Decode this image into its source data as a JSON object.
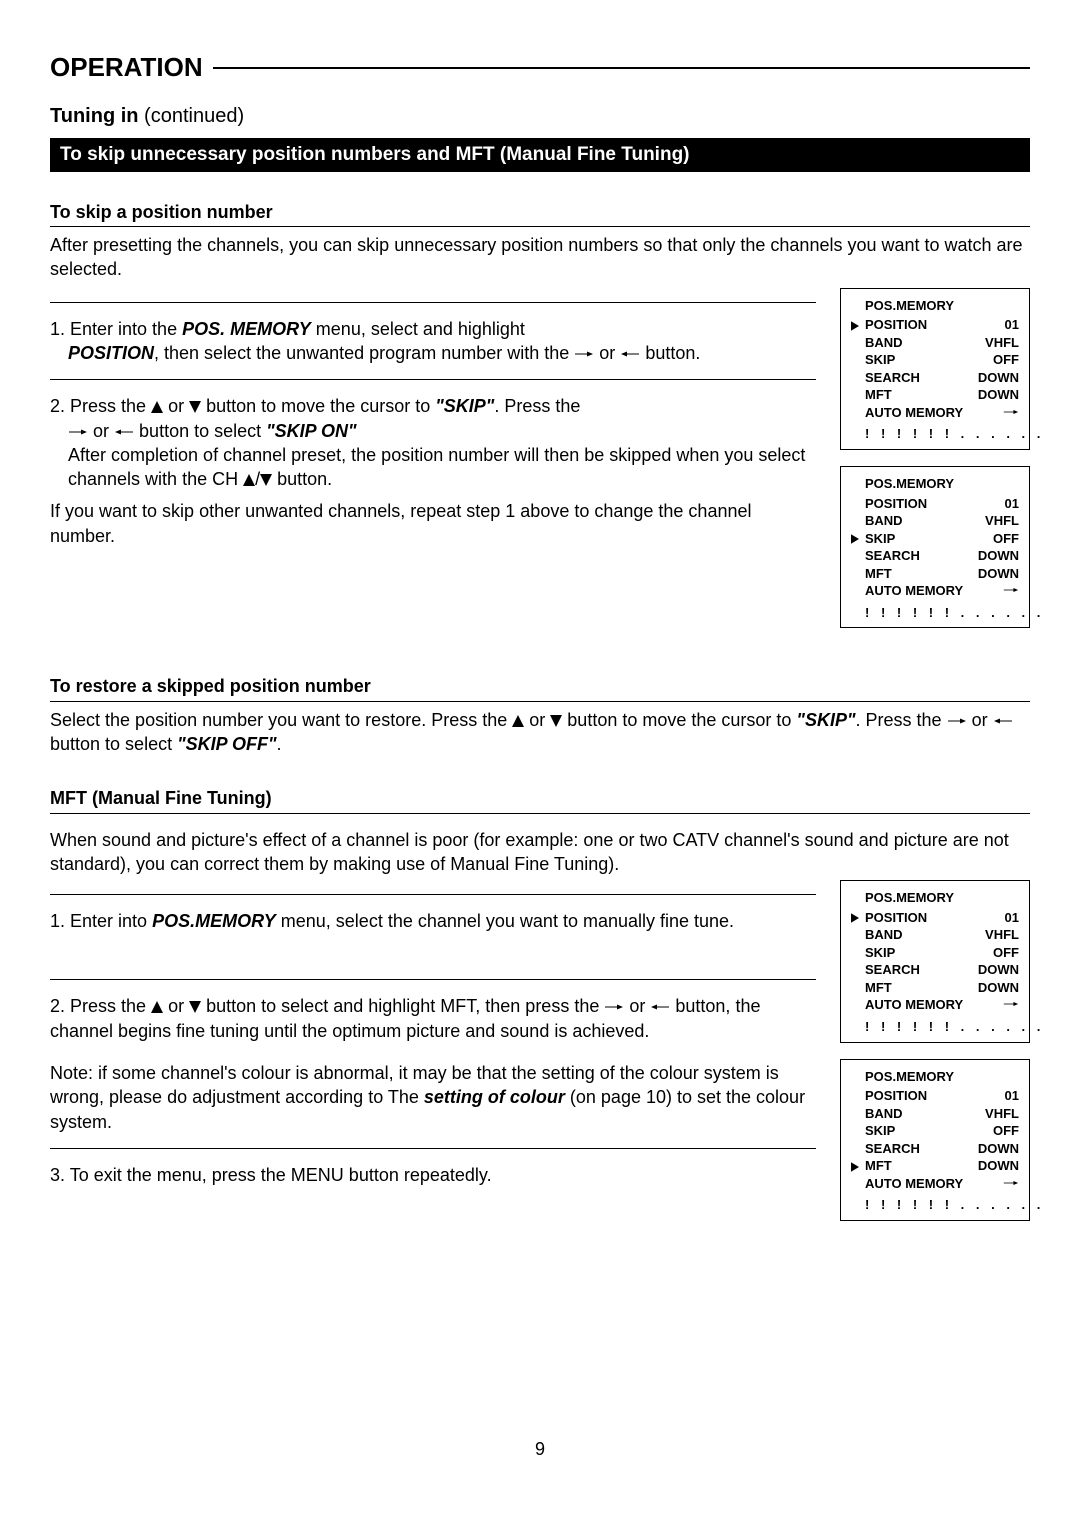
{
  "page_title": "OPERATION",
  "subtitle_bold": "Tuning in",
  "subtitle_cont": " (continued)",
  "blackbar": "To skip unnecessary position numbers and MFT (Manual Fine Tuning)",
  "skip": {
    "head": "To skip a position number",
    "intro": "After presetting the channels, you can skip unnecessary position numbers so that only the channels you want to watch are selected.",
    "step1_a": "1. Enter into the ",
    "step1_b": "POS. MEMORY",
    "step1_c": " menu, select and highlight ",
    "step1_d": "POSITION",
    "step1_e": ", then select the unwanted program number with the ",
    "step1_f": " or ",
    "step1_g": " button.",
    "step2_a": "2. Press the ",
    "step2_b": " or ",
    "step2_c": " button to move the cursor to ",
    "step2_d": "\"SKIP\"",
    "step2_e": ". Press the ",
    "step2_f": " or ",
    "step2_g": " button to select ",
    "step2_h": "\"SKIP ON\"",
    "step2_i": "After completion of channel preset, the position number will then be skipped when you select channels with the CH ",
    "step2_j": "/",
    "step2_k": " button.",
    "tail": "If you want to skip other unwanted channels, repeat step 1 above to change the channel number."
  },
  "restore": {
    "head": "To restore a skipped position number",
    "line_a": "Select the position number you want to restore. Press the ",
    "line_b": " or ",
    "line_c": " button to move the cursor to ",
    "line_d": "\"SKIP\"",
    "line_e": ". Press the ",
    "line_f": " or ",
    "line_g": " button to select ",
    "line_h": "\"SKIP OFF\"",
    "line_i": "."
  },
  "mft": {
    "head": "MFT (Manual Fine Tuning)",
    "intro": "When sound and picture's effect of a channel is poor (for example: one or two CATV channel's sound and picture are not standard), you can correct them by making use of Manual Fine Tuning).",
    "step1_a": "1. Enter into ",
    "step1_b": "POS.MEMORY",
    "step1_c": " menu, select the channel you want to manually fine tune.",
    "step2_a": "2. Press the ",
    "step2_b": " or ",
    "step2_c": " button to select and highlight MFT, then press the ",
    "step2_d": " or ",
    "step2_e": " button, the channel begins fine tuning until the optimum picture and sound is achieved.",
    "note_a": "Note: if some channel's colour is abnormal, it may be that the setting of the colour system is wrong, please do adjustment according to The ",
    "note_b": "setting of colour",
    "note_c": " (on page 10) to set the colour system.",
    "step3": "3. To exit the menu, press the MENU button repeatedly."
  },
  "osd_labels": {
    "title": "POS.MEMORY",
    "position": "POSITION",
    "band": "BAND",
    "skip": "SKIP",
    "search": "SEARCH",
    "mft": "MFT",
    "auto": "AUTO MEMORY",
    "bar": "! ! ! ! ! ! . . . . . ."
  },
  "osd_values": {
    "position": "01",
    "band": "VHFL",
    "skip": "OFF",
    "search": "DOWN",
    "mft": "DOWN"
  },
  "page_number": "9"
}
